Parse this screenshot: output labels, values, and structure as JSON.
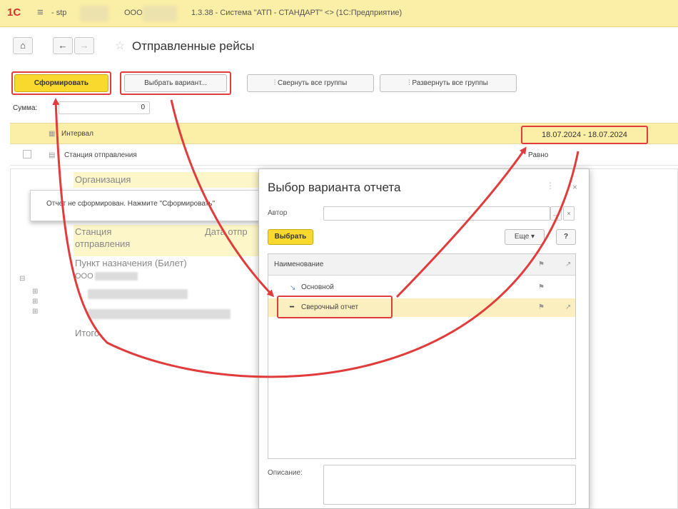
{
  "titlebar": {
    "logo": "1С",
    "menu_icon": "menu-icon",
    "text_prefix": "- stp",
    "org": "ООО",
    "app_title": "1.3.38 - Система \"АТП - СТАНДАРТ\" <> (1С:Предприятие)"
  },
  "nav": {
    "home_icon": "home-icon",
    "back_icon": "arrow-left-icon",
    "forward_icon": "arrow-right-icon",
    "favorite_icon": "star-icon",
    "page_title": "Отправленные рейсы"
  },
  "toolbar": {
    "generate": "Сформировать",
    "choose_variant": "Выбрать вариант...",
    "collapse_all": "Свернуть все группы",
    "expand_all": "Развернуть все группы"
  },
  "sum": {
    "label": "Сумма:",
    "value": "0"
  },
  "settings": {
    "row1": {
      "label": "Интервал",
      "value": "18.07.2024 - 18.07.2024"
    },
    "row2": {
      "label": "Станция отправления",
      "value": "Равно"
    }
  },
  "report": {
    "org_header": "Организация",
    "message": "Отчет не сформирован. Нажмите \"Сформировать\"",
    "station_header_1": "Станция",
    "station_header_2": "отправления",
    "date_header": "Дата отпр",
    "destination_header": "Пункт назначения (Билет)",
    "group_org": "ООО",
    "total": "Итого"
  },
  "dialog": {
    "title": "Выбор варианта отчета",
    "more": "⋮",
    "close": "×",
    "author_label": "Автор",
    "select_button": "Выбрать",
    "more_button": "Еще ▾",
    "help_button": "?",
    "column_name": "Наименование",
    "rows": [
      {
        "label": "Основной",
        "selected": false
      },
      {
        "label": "Сверочный отчет",
        "selected": true
      }
    ],
    "description_label": "Описание:"
  },
  "colors": {
    "accent_yellow": "#f9d92d",
    "header_yellow": "#fbeea6",
    "highlight_red": "#e13c3c"
  }
}
